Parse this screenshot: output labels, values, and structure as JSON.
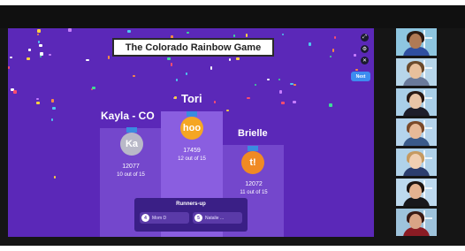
{
  "game": {
    "title": "The Colorado Rainbow Game",
    "next_label": "Next",
    "controls": [
      "expand-icon",
      "settings-icon",
      "close-icon"
    ]
  },
  "podium": {
    "first": {
      "name": "Tori",
      "initials": "hoo",
      "score": "17459",
      "rank": "12 out of 15",
      "color": "#f5a623"
    },
    "second": {
      "name": "Kayla - CO",
      "initials": "Ka",
      "score": "12077",
      "rank": "10 out of 15",
      "color": "#b9b9c8"
    },
    "third": {
      "name": "Brielle",
      "initials": "t!",
      "score": "12072",
      "rank": "11 out of 15",
      "color": "#f08a24"
    }
  },
  "runners_up": {
    "title": "Runners-up",
    "entries": [
      {
        "place": "4",
        "name": "Mom D"
      },
      {
        "place": "5",
        "name": "Natalie ..."
      }
    ]
  },
  "participants": [
    {
      "skin": "#b07a55",
      "hair": "#2b1a12",
      "shirt": "#2f4fa0",
      "bg": "#8ec6e0"
    },
    {
      "skin": "#e8c09c",
      "hair": "#6b4a2b",
      "shirt": "#6a7a9a",
      "bg": "#b7d6ea"
    },
    {
      "skin": "#e8c4a6",
      "hair": "#2a1a14",
      "shirt": "#1e1e2a",
      "bg": "#a9cfe8"
    },
    {
      "skin": "#e6b998",
      "hair": "#7a4a2a",
      "shirt": "#3a5a8a",
      "bg": "#b5d4ec"
    },
    {
      "skin": "#f0cfb2",
      "hair": "#c59a62",
      "shirt": "#2c3e6e",
      "bg": "#b0d2ea"
    },
    {
      "skin": "#e3b290",
      "hair": "#1e1410",
      "shirt": "#18181c",
      "bg": "#bdd9ee"
    },
    {
      "skin": "#d9a486",
      "hair": "#3a1a14",
      "shirt": "#8a1c24",
      "bg": "#9ec3dc"
    }
  ]
}
